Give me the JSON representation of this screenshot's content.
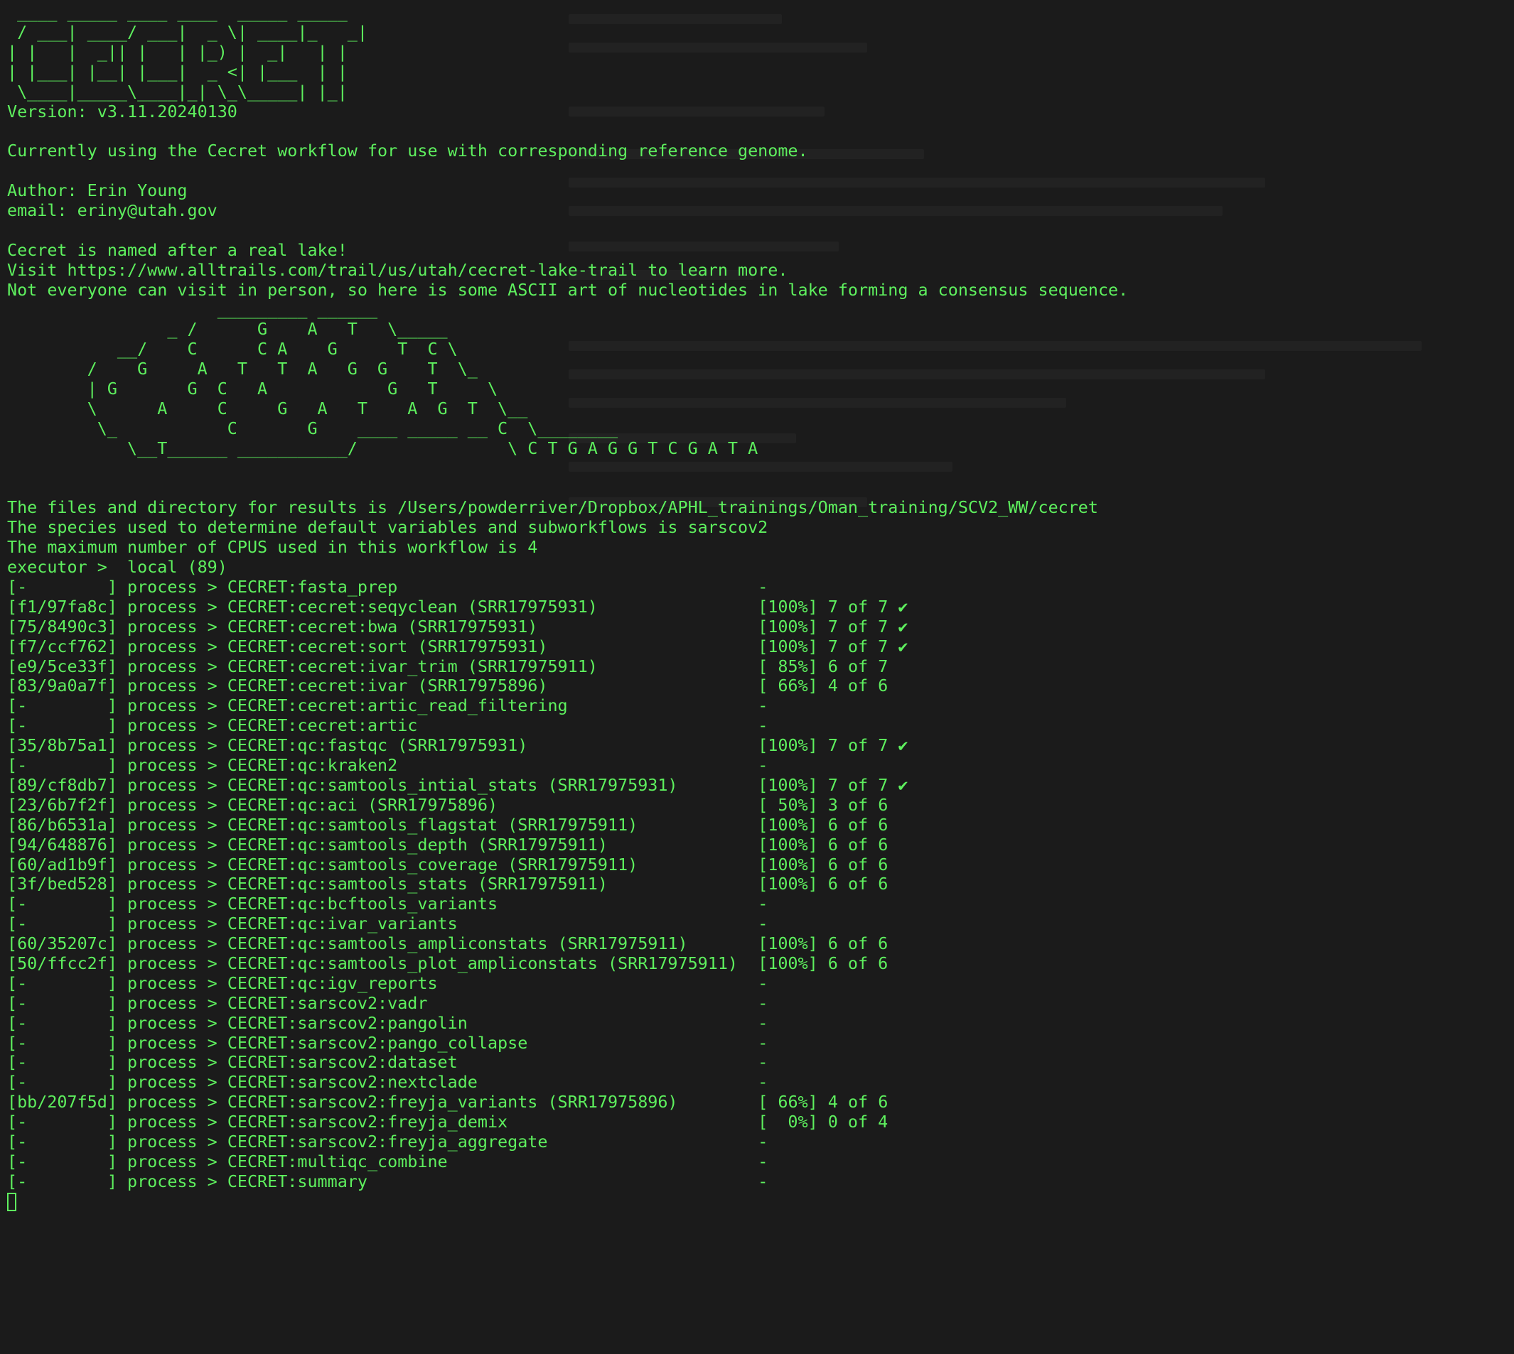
{
  "colors": {
    "background": "#1b1b1b",
    "foreground": "#5ef05e"
  },
  "banner_art": " ____ _____ ____ ____  _____ _____\n / ___| ____/ ___|  _ \\| ____|_   _|\n| |   |  _|| |   | |_) |  _|   | |\n| |___| |__| |___|  _ <| |___  | |\n \\____|_____\\____|_| \\_\\_____| |_|",
  "header": {
    "version": "Version: v3.11.20240130",
    "usage": "Currently using the Cecret workflow for use with corresponding reference genome.",
    "author": "Author: Erin Young",
    "email": "email: eriny@utah.gov",
    "lake_1": "Cecret is named after a real lake!",
    "lake_2": "Visit https://www.alltrails.com/trail/us/utah/cecret-lake-trail to learn more.",
    "lake_3": "Not everyone can visit in person, so here is some ASCII art of nucleotides in lake forming a consensus sequence."
  },
  "lake_art": "                     _________ ______\n                _ /      G    A   T   \\_____\n           __/    C      C A    G      T  C \\\n        /    G     A   T   T  A   G  G    T  \\_\n        | G       G  C   A            G   T     \\\n        \\      A     C     G   A   T    A  G  T  \\__\n         \\_           C       G    ____ _____ __ C  \\________\n            \\__T______ ___________/               \\ C T G A G G T C G A T A",
  "info": {
    "results_dir": "The files and directory for results is /Users/powderriver/Dropbox/APHL_trainings/Oman_training/SCV2_WW/cecret",
    "species": "The species used to determine default variables and subworkflows is sarscov2",
    "cpus": "The maximum number of CPUS used in this workflow is 4",
    "executor": "executor >  local (89)"
  },
  "processes": [
    {
      "hash": "[-        ]",
      "name": "CECRET:fasta_prep",
      "progress": "-",
      "check": ""
    },
    {
      "hash": "[f1/97fa8c]",
      "name": "CECRET:cecret:seqyclean (SRR17975931)",
      "progress": "[100%] 7 of 7",
      "check": "✔"
    },
    {
      "hash": "[75/8490c3]",
      "name": "CECRET:cecret:bwa (SRR17975931)",
      "progress": "[100%] 7 of 7",
      "check": "✔"
    },
    {
      "hash": "[f7/ccf762]",
      "name": "CECRET:cecret:sort (SRR17975931)",
      "progress": "[100%] 7 of 7",
      "check": "✔"
    },
    {
      "hash": "[e9/5ce33f]",
      "name": "CECRET:cecret:ivar_trim (SRR17975911)",
      "progress": "[ 85%] 6 of 7",
      "check": ""
    },
    {
      "hash": "[83/9a0a7f]",
      "name": "CECRET:cecret:ivar (SRR17975896)",
      "progress": "[ 66%] 4 of 6",
      "check": ""
    },
    {
      "hash": "[-        ]",
      "name": "CECRET:cecret:artic_read_filtering",
      "progress": "-",
      "check": ""
    },
    {
      "hash": "[-        ]",
      "name": "CECRET:cecret:artic",
      "progress": "-",
      "check": ""
    },
    {
      "hash": "[35/8b75a1]",
      "name": "CECRET:qc:fastqc (SRR17975931)",
      "progress": "[100%] 7 of 7",
      "check": "✔"
    },
    {
      "hash": "[-        ]",
      "name": "CECRET:qc:kraken2",
      "progress": "-",
      "check": ""
    },
    {
      "hash": "[89/cf8db7]",
      "name": "CECRET:qc:samtools_intial_stats (SRR17975931)",
      "progress": "[100%] 7 of 7",
      "check": "✔"
    },
    {
      "hash": "[23/6b7f2f]",
      "name": "CECRET:qc:aci (SRR17975896)",
      "progress": "[ 50%] 3 of 6",
      "check": ""
    },
    {
      "hash": "[86/b6531a]",
      "name": "CECRET:qc:samtools_flagstat (SRR17975911)",
      "progress": "[100%] 6 of 6",
      "check": ""
    },
    {
      "hash": "[94/648876]",
      "name": "CECRET:qc:samtools_depth (SRR17975911)",
      "progress": "[100%] 6 of 6",
      "check": ""
    },
    {
      "hash": "[60/ad1b9f]",
      "name": "CECRET:qc:samtools_coverage (SRR17975911)",
      "progress": "[100%] 6 of 6",
      "check": ""
    },
    {
      "hash": "[3f/bed528]",
      "name": "CECRET:qc:samtools_stats (SRR17975911)",
      "progress": "[100%] 6 of 6",
      "check": ""
    },
    {
      "hash": "[-        ]",
      "name": "CECRET:qc:bcftools_variants",
      "progress": "-",
      "check": ""
    },
    {
      "hash": "[-        ]",
      "name": "CECRET:qc:ivar_variants",
      "progress": "-",
      "check": ""
    },
    {
      "hash": "[60/35207c]",
      "name": "CECRET:qc:samtools_ampliconstats (SRR17975911)",
      "progress": "[100%] 6 of 6",
      "check": ""
    },
    {
      "hash": "[50/ffcc2f]",
      "name": "CECRET:qc:samtools_plot_ampliconstats (SRR17975911)",
      "progress": "[100%] 6 of 6",
      "check": ""
    },
    {
      "hash": "[-        ]",
      "name": "CECRET:qc:igv_reports",
      "progress": "-",
      "check": ""
    },
    {
      "hash": "[-        ]",
      "name": "CECRET:sarscov2:vadr",
      "progress": "-",
      "check": ""
    },
    {
      "hash": "[-        ]",
      "name": "CECRET:sarscov2:pangolin",
      "progress": "-",
      "check": ""
    },
    {
      "hash": "[-        ]",
      "name": "CECRET:sarscov2:pango_collapse",
      "progress": "-",
      "check": ""
    },
    {
      "hash": "[-        ]",
      "name": "CECRET:sarscov2:dataset",
      "progress": "-",
      "check": ""
    },
    {
      "hash": "[-        ]",
      "name": "CECRET:sarscov2:nextclade",
      "progress": "-",
      "check": ""
    },
    {
      "hash": "[bb/207f5d]",
      "name": "CECRET:sarscov2:freyja_variants (SRR17975896)",
      "progress": "[ 66%] 4 of 6",
      "check": ""
    },
    {
      "hash": "[-        ]",
      "name": "CECRET:sarscov2:freyja_demix",
      "progress": "[  0%] 0 of 4",
      "check": ""
    },
    {
      "hash": "[-        ]",
      "name": "CECRET:sarscov2:freyja_aggregate",
      "progress": "-",
      "check": ""
    },
    {
      "hash": "[-        ]",
      "name": "CECRET:multiqc_combine",
      "progress": "-",
      "check": ""
    },
    {
      "hash": "[-        ]",
      "name": "CECRET:summary",
      "progress": "-",
      "check": ""
    }
  ]
}
